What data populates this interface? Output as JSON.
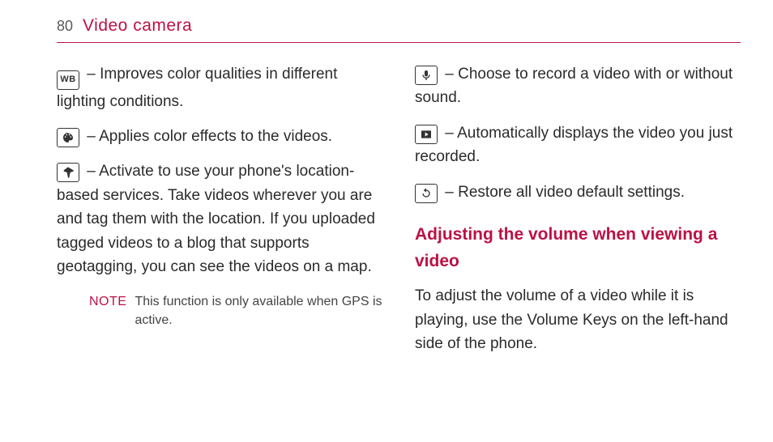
{
  "header": {
    "page_number": "80",
    "title": "Video camera"
  },
  "left": {
    "items": [
      {
        "icon": "wb-icon",
        "text": " – Improves color qualities in different lighting conditions."
      },
      {
        "icon": "palette-icon",
        "text": " – Applies color effects to the videos."
      },
      {
        "icon": "geotag-icon",
        "text": " – Activate to use your phone's location-based services. Take videos wherever you are and tag them with the location. If you uploaded tagged videos to a blog that supports geotagging, you can see the videos on a map."
      }
    ],
    "note_label": "NOTE",
    "note_text": "This function is only available when GPS is active."
  },
  "right": {
    "items": [
      {
        "icon": "mic-icon",
        "text": " – Choose to record a video with or without sound."
      },
      {
        "icon": "play-icon",
        "text": " – Automatically displays the video you just recorded."
      },
      {
        "icon": "reset-icon",
        "text": " – Restore all video default settings."
      }
    ],
    "heading": "Adjusting the volume when viewing a video",
    "body": "To adjust the volume of a video while it is playing, use the Volume Keys on the left-hand side of the phone."
  }
}
